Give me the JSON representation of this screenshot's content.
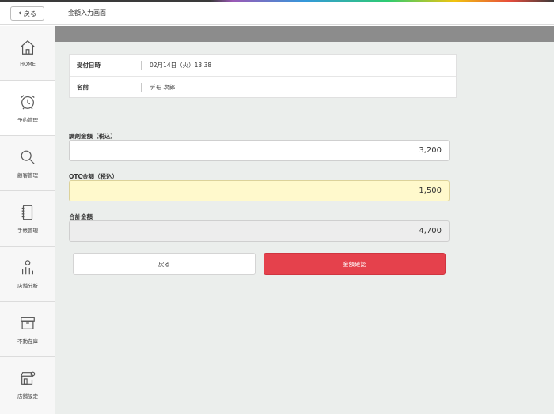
{
  "header": {
    "back_label": "戻る",
    "title": "金額入力画面"
  },
  "sidebar": {
    "items": [
      {
        "label": "HOME",
        "icon": "home-icon"
      },
      {
        "label": "予約管理",
        "icon": "alarm-clock-icon"
      },
      {
        "label": "顧客管理",
        "icon": "search-icon"
      },
      {
        "label": "手帳管理",
        "icon": "notebook-icon"
      },
      {
        "label": "店舗分析",
        "icon": "analytics-icon"
      },
      {
        "label": "不動在庫",
        "icon": "inventory-box-icon"
      },
      {
        "label": "店舗設定",
        "icon": "store-settings-icon"
      }
    ],
    "active_index": 1
  },
  "info": {
    "received_label": "受付日時",
    "received_value": "02月14日（火）13:38",
    "name_label": "名前",
    "name_value": "デモ 次郎"
  },
  "form": {
    "dispensing_label": "調剤金額（税込）",
    "dispensing_value": "3,200",
    "otc_label": "OTC金額（税込）",
    "otc_value": "1,500",
    "total_label": "合計金額",
    "total_value": "4,700"
  },
  "actions": {
    "back_label": "戻る",
    "confirm_label": "金額確認"
  },
  "colors": {
    "accent": "#e5414c",
    "highlight_field": "#fff9cc",
    "content_bg": "#ebeeec",
    "header_bar": "#8c8c8c"
  }
}
